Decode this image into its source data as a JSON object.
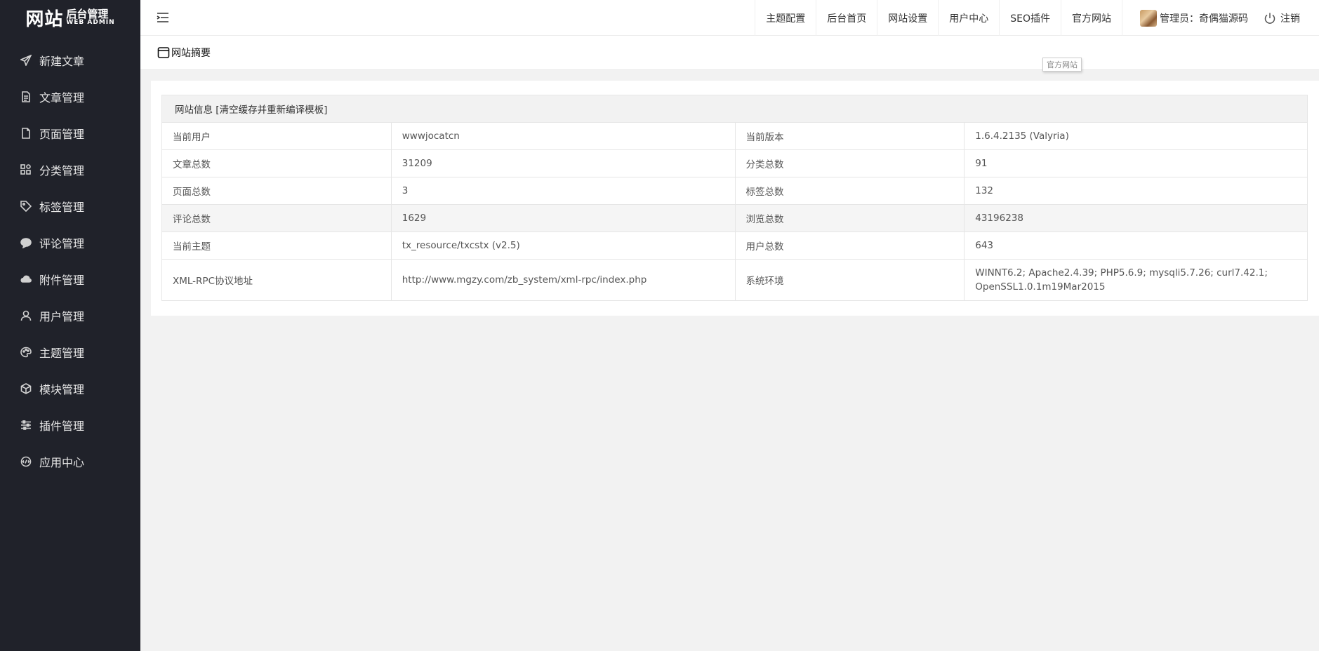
{
  "logo": {
    "big": "网站",
    "small": "后台管理",
    "en": "WEB ADMIN"
  },
  "sidebar": {
    "items": [
      {
        "label": "新建文章",
        "icon": "paper-plane-icon"
      },
      {
        "label": "文章管理",
        "icon": "document-icon"
      },
      {
        "label": "页面管理",
        "icon": "page-icon"
      },
      {
        "label": "分类管理",
        "icon": "category-grid-icon"
      },
      {
        "label": "标签管理",
        "icon": "tag-icon"
      },
      {
        "label": "评论管理",
        "icon": "comment-icon"
      },
      {
        "label": "附件管理",
        "icon": "cloud-upload-icon"
      },
      {
        "label": "用户管理",
        "icon": "user-icon"
      },
      {
        "label": "主题管理",
        "icon": "palette-icon"
      },
      {
        "label": "模块管理",
        "icon": "cube-icon"
      },
      {
        "label": "插件管理",
        "icon": "sliders-icon"
      },
      {
        "label": "应用中心",
        "icon": "app-center-icon"
      }
    ]
  },
  "header": {
    "nav": [
      "主题配置",
      "后台首页",
      "网站设置",
      "用户中心",
      "SEO插件",
      "官方网站"
    ],
    "user": "管理员：奇偶猫源码",
    "logout": "注销"
  },
  "subheader": {
    "title": "网站摘要"
  },
  "tooltip": "官方网站",
  "table": {
    "title": "网站信息",
    "action": "[清空缓存并重新编译模板]",
    "rows": [
      {
        "k1": "当前用户",
        "v1": "wwwjocatcn",
        "k2": "当前版本",
        "v2": "1.6.4.2135 (Valyria)"
      },
      {
        "k1": "文章总数",
        "v1": "31209",
        "k2": "分类总数",
        "v2": "91"
      },
      {
        "k1": "页面总数",
        "v1": "3",
        "k2": "标签总数",
        "v2": "132"
      },
      {
        "k1": "评论总数",
        "v1": "1629",
        "k2": "浏览总数",
        "v2": "43196238"
      },
      {
        "k1": "当前主题",
        "v1": "tx_resource/txcstx (v2.5)",
        "k2": "用户总数",
        "v2": "643"
      },
      {
        "k1": "XML-RPC协议地址",
        "v1": "http://www.mgzy.com/zb_system/xml-rpc/index.php",
        "k2": "系统环境",
        "v2": "WINNT6.2; Apache2.4.39; PHP5.6.9; mysqli5.7.26; curl7.42.1; OpenSSL1.0.1m19Mar2015"
      }
    ]
  }
}
